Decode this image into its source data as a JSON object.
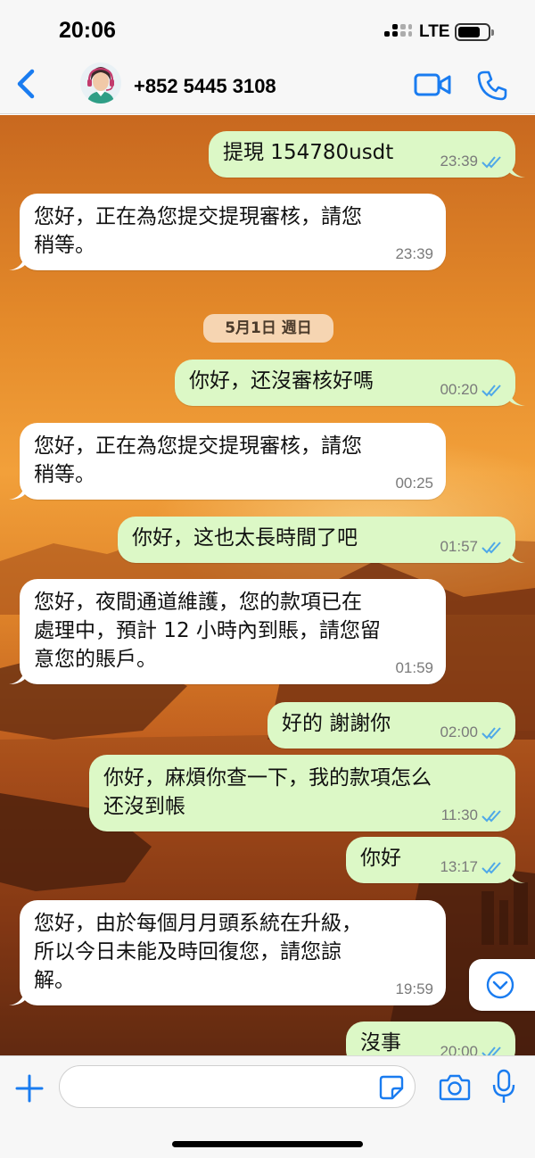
{
  "status_bar": {
    "time": "20:06",
    "network": "LTE"
  },
  "header": {
    "contact_name": "+852 5445 3108",
    "icons": [
      "back-icon",
      "avatar",
      "video-call-icon",
      "phone-call-icon"
    ]
  },
  "date_separator": "5月1日 週日",
  "messages": [
    {
      "direction": "out",
      "text": "提現 154780usdt",
      "time": "23:39",
      "status": "read"
    },
    {
      "direction": "in",
      "text": "您好，正在為您提交提現審核，請您\n稍等。",
      "time": "23:39"
    },
    {
      "direction": "out",
      "text": "你好，还沒審核好嗎",
      "time": "00:20",
      "status": "read"
    },
    {
      "direction": "in",
      "text": "您好，正在為您提交提現審核，請您\n稍等。",
      "time": "00:25"
    },
    {
      "direction": "out",
      "text": "你好，这也太長時間了吧",
      "time": "01:57",
      "status": "read"
    },
    {
      "direction": "in",
      "text": "您好，夜間通道維護，您的款項已在\n處理中，預計 12 小時內到賬，請您留\n意您的賬戶。",
      "time": "01:59"
    },
    {
      "direction": "out",
      "text": "好的 謝謝你",
      "time": "02:00",
      "status": "read"
    },
    {
      "direction": "out",
      "text": "你好，麻煩你查一下，我的款項怎么\n还沒到帳",
      "time": "11:30",
      "status": "read"
    },
    {
      "direction": "out",
      "text": "你好",
      "time": "13:17",
      "status": "read"
    },
    {
      "direction": "in",
      "text": "您好，由於每個月月頭系統在升級，\n所以今日未能及時回復您，請您諒\n解。",
      "time": "19:59"
    },
    {
      "direction": "out",
      "text": "沒事",
      "time": "20:00",
      "status": "read"
    }
  ],
  "composer": {
    "placeholder": ""
  },
  "colors": {
    "outgoing_bubble": "#dcf8c6",
    "incoming_bubble": "#ffffff",
    "accent": "#1a7cf0",
    "read_ticks": "#4fa8e8"
  }
}
